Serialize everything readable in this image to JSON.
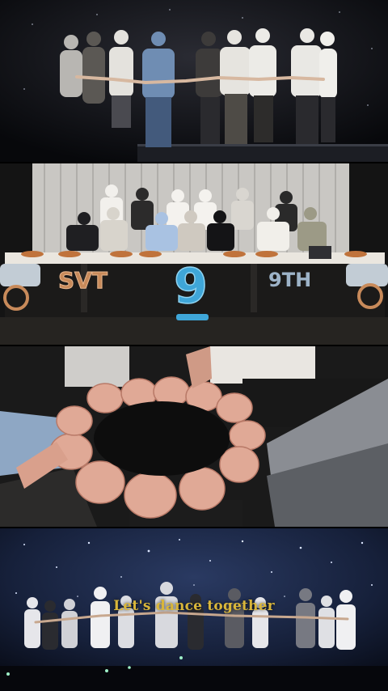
{
  "panels": [
    {
      "scene": "stage-group-hands-joined"
    },
    {
      "scene": "anniversary-table-photo",
      "balloons": {
        "left_text": "SVT",
        "number": "9",
        "right_text": "9TH"
      }
    },
    {
      "scene": "hands-circle-closeup"
    },
    {
      "scene": "concert-stage-under-stars",
      "caption": "Let's dance together"
    }
  ],
  "colors": {
    "caption": "#d9b63a",
    "balloon_gold": "#c88a5a",
    "balloon_blue": "#3fa6d8",
    "sky": "#1a2340"
  }
}
